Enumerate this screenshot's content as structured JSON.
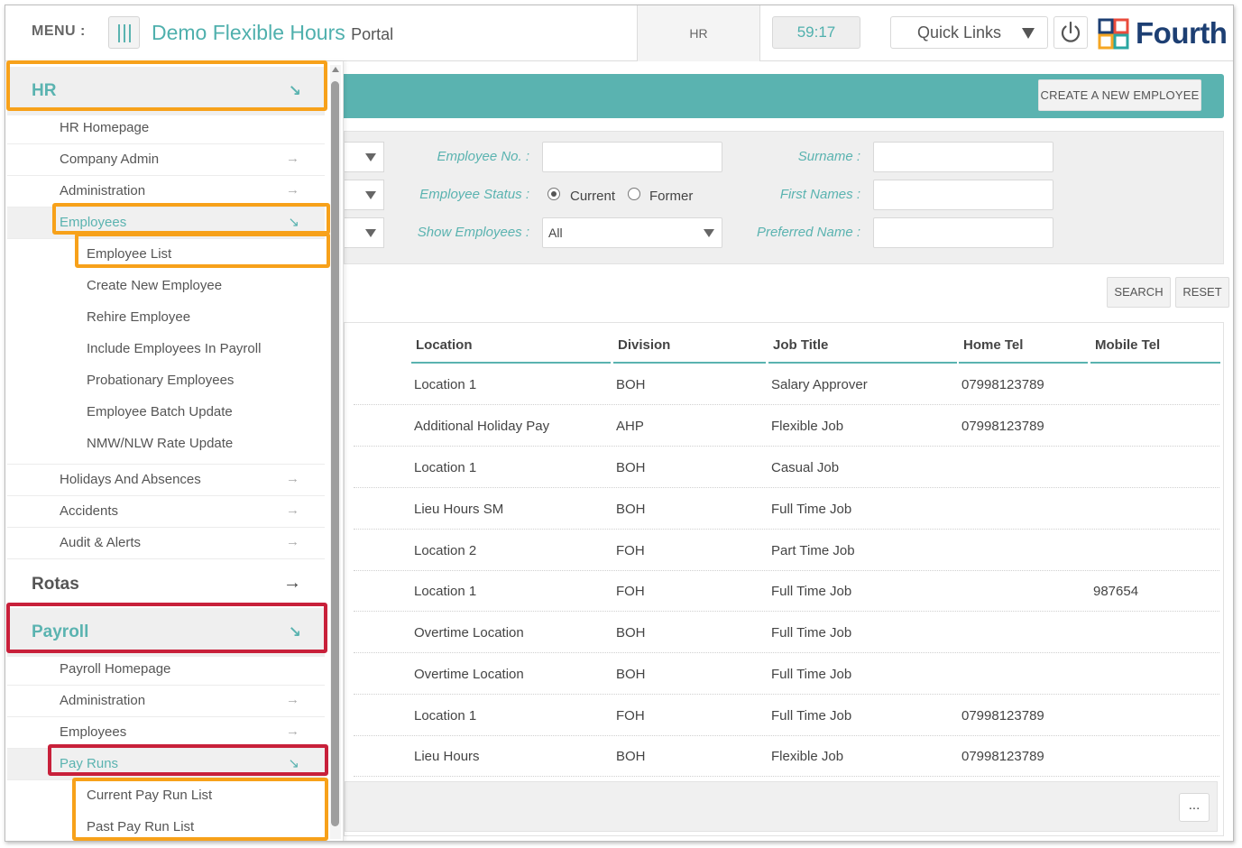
{
  "header": {
    "menu_label": "MENU :",
    "portal_title": "Demo Flexible Hours",
    "portal_suffix": "Portal",
    "section": "HR",
    "timer": "59:17",
    "quick_links": "Quick Links",
    "brand": "Fourth",
    "colors": {
      "accent": "#5ab3b0",
      "brand": "#1d3f73"
    }
  },
  "sidebar": {
    "hr": {
      "title": "HR",
      "arrow": "↘",
      "items": [
        {
          "label": "HR Homepage",
          "arrow": ""
        },
        {
          "label": "Company Admin",
          "arrow": "→"
        },
        {
          "label": "Administration",
          "arrow": "→"
        },
        {
          "label": "Employees",
          "arrow": "↘"
        }
      ],
      "employees_sub": [
        "Employee List",
        "Create New Employee",
        "Rehire Employee",
        "Include Employees In Payroll",
        "Probationary Employees",
        "Employee Batch Update",
        "NMW/NLW Rate Update"
      ],
      "items_after": [
        {
          "label": "Holidays And Absences",
          "arrow": "→"
        },
        {
          "label": "Accidents",
          "arrow": "→"
        },
        {
          "label": "Audit & Alerts",
          "arrow": "→"
        }
      ]
    },
    "rotas": {
      "title": "Rotas",
      "arrow": "→"
    },
    "payroll": {
      "title": "Payroll",
      "arrow": "↘",
      "items": [
        {
          "label": "Payroll Homepage",
          "arrow": ""
        },
        {
          "label": "Administration",
          "arrow": "→"
        },
        {
          "label": "Employees",
          "arrow": "→"
        },
        {
          "label": "Pay Runs",
          "arrow": "↘"
        }
      ],
      "payruns_sub": [
        "Current Pay Run List",
        "Past Pay Run List"
      ]
    }
  },
  "main": {
    "create_button": "CREATE A NEW EMPLOYEE",
    "filters": {
      "employee_no": "Employee No. :",
      "employee_status": "Employee Status :",
      "status_current": "Current",
      "status_former": "Former",
      "show_employees": "Show Employees :",
      "show_value": "All",
      "surname": "Surname :",
      "first_names": "First Names :",
      "preferred_name": "Preferred Name :"
    },
    "search_button": "SEARCH",
    "reset_button": "RESET",
    "table": {
      "columns": [
        "Location",
        "Division",
        "Job Title",
        "Home Tel",
        "Mobile Tel"
      ],
      "rows": [
        [
          "Location 1",
          "BOH",
          "Salary Approver",
          "07998123789",
          ""
        ],
        [
          "Additional Holiday Pay",
          "AHP",
          "Flexible Job",
          "07998123789",
          ""
        ],
        [
          "Location 1",
          "BOH",
          "Casual Job",
          "",
          ""
        ],
        [
          "Lieu Hours SM",
          "BOH",
          "Full Time Job",
          "",
          ""
        ],
        [
          "Location 2",
          "FOH",
          "Part Time Job",
          "",
          ""
        ],
        [
          "Location 1",
          "FOH",
          "Full Time Job",
          "",
          "987654"
        ],
        [
          "Overtime Location",
          "BOH",
          "Full Time Job",
          "",
          ""
        ],
        [
          "Overtime Location",
          "BOH",
          "Full Time Job",
          "",
          ""
        ],
        [
          "Location 1",
          "FOH",
          "Full Time Job",
          "07998123789",
          ""
        ],
        [
          "Lieu Hours",
          "BOH",
          "Flexible Job",
          "07998123789",
          ""
        ]
      ]
    },
    "more_button": "..."
  }
}
